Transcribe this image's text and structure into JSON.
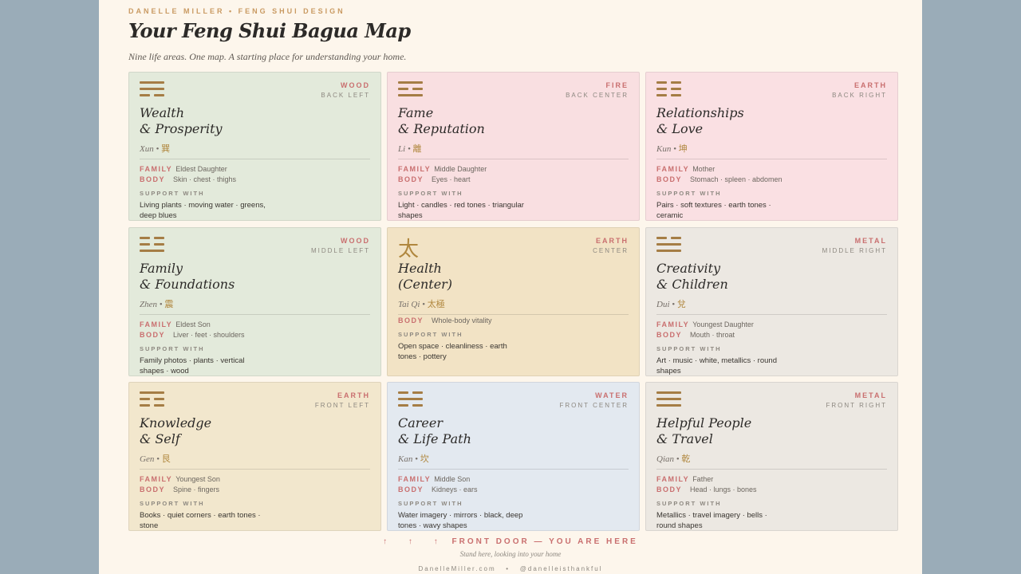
{
  "brand": "DANELLE MILLER • FENG SHUI DESIGN",
  "title": "Your Feng Shui Bagua Map",
  "subtitle": "Nine life areas. One map. A starting place for understanding your home.",
  "colors": {
    "wood": "#e3eadb",
    "fire": "#f9dfe1",
    "earth_pink": "#fae0e3",
    "earth_center": "#f2e3c5",
    "metal": "#ece8e2",
    "earth_front": "#f2e7cd",
    "water": "#e3e9f0",
    "accent": "#c96f6f",
    "trigram": "#a57d45"
  },
  "labels": {
    "family": "FAMILY",
    "body": "BODY",
    "support": "SUPPORT WITH"
  },
  "cards": [
    {
      "icon": "trigram-xun-icon",
      "element": "WOOD",
      "position": "BACK LEFT",
      "name1": "Wealth",
      "name2": "& Prosperity",
      "trigram": "Xun",
      "han": "巽",
      "family": "Eldest Daughter",
      "body": "Skin · chest · thighs",
      "support": "Living plants · moving water · greens, deep blues"
    },
    {
      "icon": "trigram-li-icon",
      "element": "FIRE",
      "position": "BACK CENTER",
      "name1": "Fame",
      "name2": "& Reputation",
      "trigram": "Li",
      "han": "離",
      "family": "Middle Daughter",
      "body": "Eyes · heart",
      "support": "Light · candles · red tones · triangular shapes"
    },
    {
      "icon": "trigram-kun-icon",
      "element": "EARTH",
      "position": "BACK RIGHT",
      "name1": "Relationships",
      "name2": "& Love",
      "trigram": "Kun",
      "han": "坤",
      "family": "Mother",
      "body": "Stomach · spleen · abdomen",
      "support": "Pairs · soft textures · earth tones · ceramic"
    },
    {
      "icon": "trigram-zhen-icon",
      "element": "WOOD",
      "position": "MIDDLE LEFT",
      "name1": "Family",
      "name2": "& Foundations",
      "trigram": "Zhen",
      "han": "震",
      "family": "Eldest Son",
      "body": "Liver · feet · shoulders",
      "support": "Family photos · plants · vertical shapes · wood"
    },
    {
      "icon": "tai-character-icon",
      "element": "EARTH",
      "position": "CENTER",
      "name1": "Health",
      "name2": "(Center)",
      "trigram": "Tai Qi",
      "han": "太極",
      "glyph": "太",
      "body": "Whole-body vitality",
      "support": "Open space · cleanliness · earth tones · pottery"
    },
    {
      "icon": "trigram-dui-icon",
      "element": "METAL",
      "position": "MIDDLE RIGHT",
      "name1": "Creativity",
      "name2": "& Children",
      "trigram": "Dui",
      "han": "兌",
      "family": "Youngest Daughter",
      "body": "Mouth · throat",
      "support": "Art · music · white, metallics · round shapes"
    },
    {
      "icon": "trigram-gen-icon",
      "element": "EARTH",
      "position": "FRONT LEFT",
      "name1": "Knowledge",
      "name2": "& Self",
      "trigram": "Gen",
      "han": "艮",
      "family": "Youngest Son",
      "body": "Spine · fingers",
      "support": "Books · quiet corners · earth tones · stone"
    },
    {
      "icon": "trigram-kan-icon",
      "element": "WATER",
      "position": "FRONT CENTER",
      "name1": "Career",
      "name2": "& Life Path",
      "trigram": "Kan",
      "han": "坎",
      "family": "Middle Son",
      "body": "Kidneys · ears",
      "support": "Water imagery · mirrors · black, deep tones · wavy shapes"
    },
    {
      "icon": "trigram-qian-icon",
      "element": "METAL",
      "position": "FRONT RIGHT",
      "name1": "Helpful People",
      "name2": "& Travel",
      "trigram": "Qian",
      "han": "乾",
      "family": "Father",
      "body": "Head · lungs · bones",
      "support": "Metallics · travel imagery · bells · round shapes"
    }
  ],
  "front": {
    "arrows": "↑ ↑ ↑",
    "text": "FRONT DOOR — YOU ARE HERE",
    "stand": "Stand here, looking into your home"
  },
  "footer": {
    "site": "DanelleMiller.com",
    "sep": "•",
    "handle": "@danelleisthankful"
  }
}
